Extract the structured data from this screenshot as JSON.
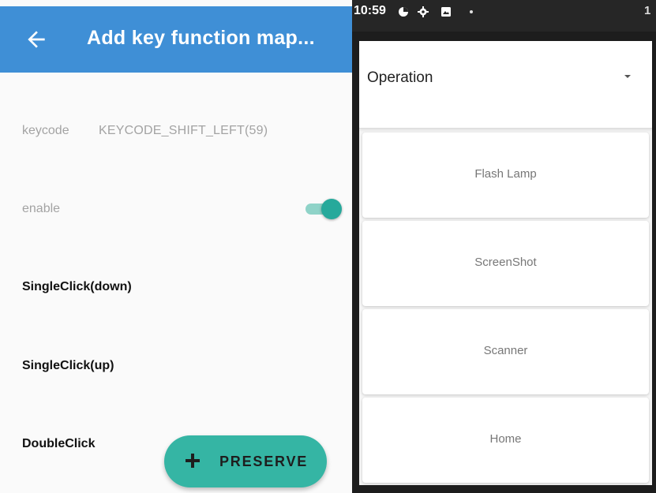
{
  "app_bar": {
    "title": "Add key function map..."
  },
  "settings": {
    "keycode_label": "keycode",
    "keycode_value": "KEYCODE_SHIFT_LEFT(59)",
    "enable_label": "enable",
    "enable_on": true,
    "actions": [
      "SingleClick(down)",
      "SingleClick(up)",
      "DoubleClick"
    ]
  },
  "fab": {
    "label": "PRESERVE"
  },
  "status_bar": {
    "time": "10:59",
    "right_text": "1"
  },
  "dropdown": {
    "selected": "Operation",
    "options": [
      "Flash Lamp",
      "ScreenShot",
      "Scanner",
      "Home"
    ]
  },
  "colors": {
    "app_bar": "#3f8fd6",
    "accent": "#35b5a4",
    "toggle_on": "#26a99b"
  }
}
